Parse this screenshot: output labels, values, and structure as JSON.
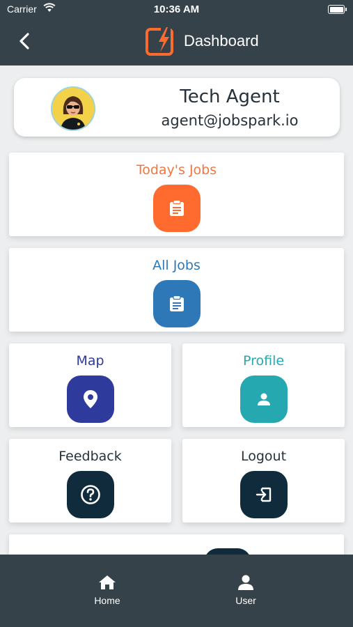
{
  "status_bar": {
    "carrier": "Carrier",
    "time": "10:36 AM"
  },
  "header": {
    "title": "Dashboard"
  },
  "profile": {
    "name": "Tech Agent",
    "email": "agent@jobspark.io"
  },
  "tiles": [
    {
      "label": "Today's Jobs",
      "icon": "clipboard-icon",
      "color": "#ff6a2e",
      "label_color": "#f2763f"
    },
    {
      "label": "All Jobs",
      "icon": "clipboard-icon",
      "color": "#2f78b7",
      "label_color": "#2f78b7"
    },
    {
      "label": "Map",
      "icon": "map-pin-icon",
      "color": "#2e3a9c",
      "label_color": "#2e3a9c"
    },
    {
      "label": "Profile",
      "icon": "person-icon",
      "color": "#25a8b0",
      "label_color": "#25a8b0"
    },
    {
      "label": "Feedback",
      "icon": "question-icon",
      "color": "#0f2b3c",
      "label_color": "#26313a"
    },
    {
      "label": "Logout",
      "icon": "logout-icon",
      "color": "#0f2b3c",
      "label_color": "#26313a"
    }
  ],
  "tabbar": {
    "home": "Home",
    "user": "User"
  },
  "colors": {
    "nav_bar": "#36424a",
    "accent": "#ff6a2e"
  }
}
